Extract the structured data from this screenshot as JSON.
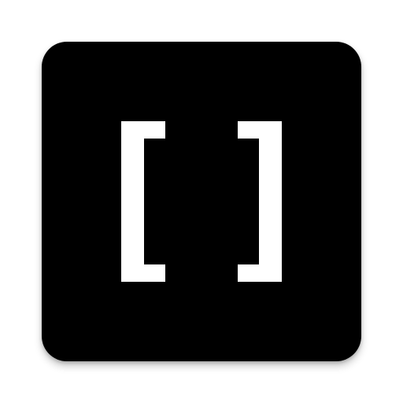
{
  "app_icon": {
    "icon_name": "brackets-icon",
    "colors": {
      "tile_background": "#000000",
      "glyph": "#ffffff",
      "page_background": "#ffffff"
    }
  }
}
